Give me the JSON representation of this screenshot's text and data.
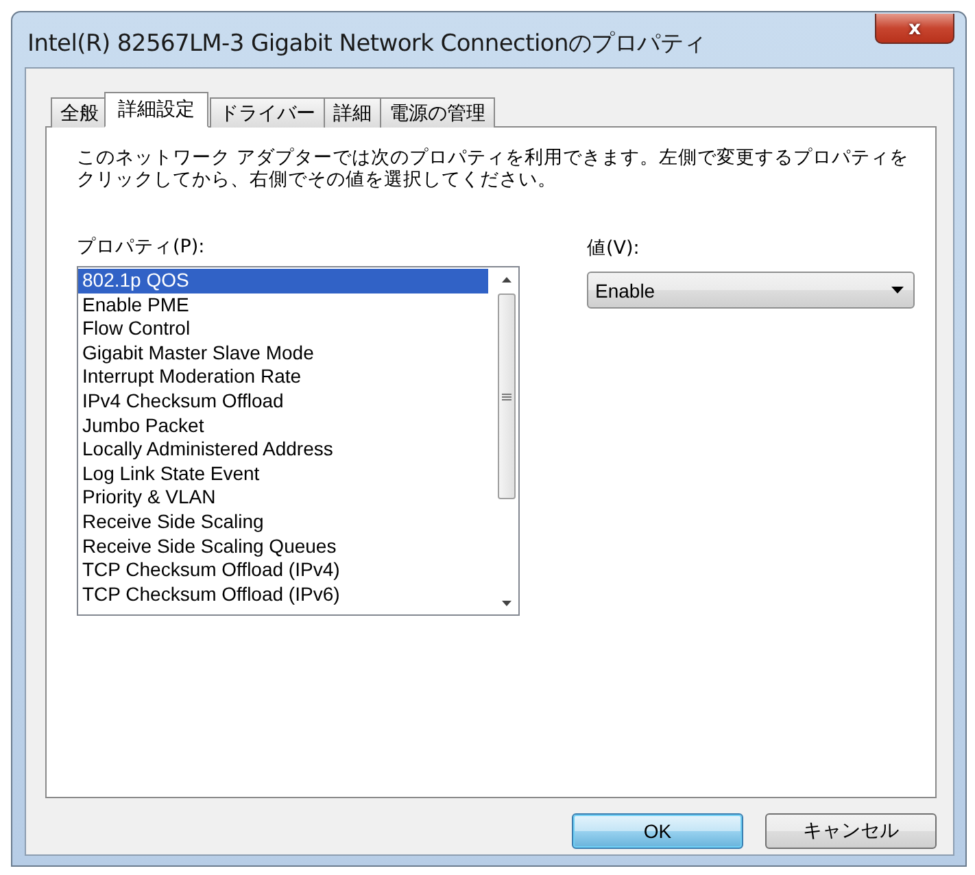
{
  "window": {
    "title": "Intel(R) 82567LM-3 Gigabit Network Connectionのプロパティ",
    "close": "x"
  },
  "tabs": [
    {
      "label": "全般",
      "selected": false
    },
    {
      "label": "詳細設定",
      "selected": true
    },
    {
      "label": "ドライバー",
      "selected": false
    },
    {
      "label": "詳細",
      "selected": false
    },
    {
      "label": "電源の管理",
      "selected": false
    }
  ],
  "description": "このネットワーク アダプターでは次のプロパティを利用できます。左側で変更するプロパティをクリックしてから、右側でその値を選択してください。",
  "property_list": {
    "label": "プロパティ(P):",
    "items": [
      {
        "label": "802.1p QOS",
        "selected": true
      },
      {
        "label": "Enable PME",
        "selected": false
      },
      {
        "label": "Flow Control",
        "selected": false
      },
      {
        "label": "Gigabit Master Slave Mode",
        "selected": false
      },
      {
        "label": "Interrupt Moderation Rate",
        "selected": false
      },
      {
        "label": "IPv4 Checksum Offload",
        "selected": false
      },
      {
        "label": "Jumbo Packet",
        "selected": false
      },
      {
        "label": "Locally Administered Address",
        "selected": false
      },
      {
        "label": "Log Link State Event",
        "selected": false
      },
      {
        "label": "Priority & VLAN",
        "selected": false
      },
      {
        "label": "Receive Side Scaling",
        "selected": false
      },
      {
        "label": "Receive Side Scaling Queues",
        "selected": false
      },
      {
        "label": "TCP Checksum Offload (IPv4)",
        "selected": false
      },
      {
        "label": "TCP Checksum Offload (IPv6)",
        "selected": false
      }
    ]
  },
  "value": {
    "label": "値(V):",
    "selected_value": "Enable"
  },
  "buttons": [
    {
      "label": "OK",
      "default": true
    },
    {
      "label": "キャンセル",
      "default": false
    }
  ]
}
